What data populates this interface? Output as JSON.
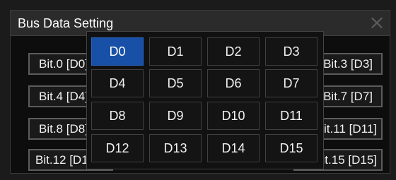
{
  "dialog": {
    "title": "Bus Data Setting",
    "close_glyph": "×"
  },
  "bit_buttons": {
    "bit0": "Bit.0 [D0]",
    "bit3": "Bit.3 [D3]",
    "bit4": "Bit.4 [D4]",
    "bit7": "Bit.7 [D7]",
    "bit8": "Bit.8 [D8]",
    "bit11": "Bit.11 [D11]",
    "bit12": "Bit.12 [D12]",
    "bit15": "Bit.15 [D15]"
  },
  "channel_picker": {
    "selected": "D0",
    "options": [
      "D0",
      "D1",
      "D2",
      "D3",
      "D4",
      "D5",
      "D6",
      "D7",
      "D8",
      "D9",
      "D10",
      "D11",
      "D12",
      "D13",
      "D14",
      "D15"
    ]
  },
  "colors": {
    "selected_bg": "#1750a6",
    "background": "#0d0d0d"
  }
}
